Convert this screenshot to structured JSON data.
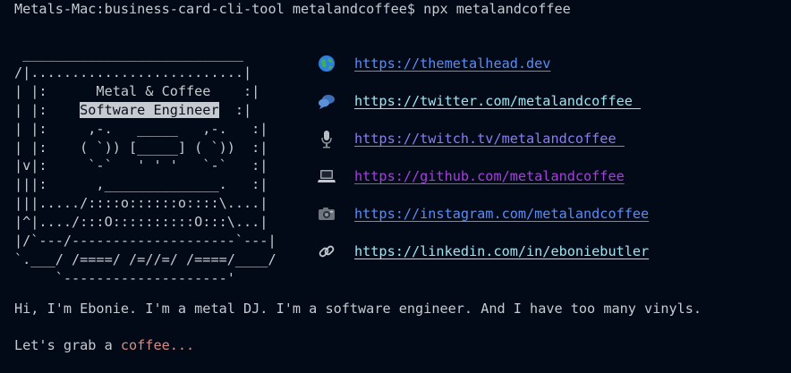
{
  "terminal": {
    "prompt_line": "Metals-Mac:business-card-cli-tool metalandcoffee$ npx metalandcoffee"
  },
  "card": {
    "top_border": " ___________________________",
    "rows": [
      {
        "pre": "/|..........................|",
        "hl": "",
        "post": ""
      },
      {
        "pre": "| |:      Metal & Coffee    :|",
        "hl": "",
        "post": ""
      },
      {
        "pre": "| |:    ",
        "hl": "Software Engineer",
        "post": "  :|"
      },
      {
        "pre": "| |:     ,-.   _____   ,-.   :|",
        "hl": "",
        "post": ""
      },
      {
        "pre": "| |:    ( `)) [_____] ( `))  :|",
        "hl": "",
        "post": ""
      },
      {
        "pre": "|v|:     `-`   ' ' '   `-`   :|",
        "hl": "",
        "post": ""
      },
      {
        "pre": "|||:      ,______________.   :|",
        "hl": "",
        "post": ""
      },
      {
        "pre": "|||...../::::o::::::o::::\\....|",
        "hl": "",
        "post": ""
      },
      {
        "pre": "|^|..../:::O::::::::::O:::\\...|",
        "hl": "",
        "post": ""
      },
      {
        "pre": "|/`---/--------------------`---|",
        "hl": "",
        "post": ""
      },
      {
        "pre": "`.___/ /====/ /=//=/ /====/____/",
        "hl": "",
        "post": ""
      },
      {
        "pre": "     `--------------------'",
        "hl": "",
        "post": ""
      }
    ]
  },
  "links": [
    {
      "icon": "globe-icon",
      "text": "https://themetalhead.dev",
      "color": "#5b8cf5"
    },
    {
      "icon": "speech-bubbles-icon",
      "text": "https://twitter.com/metalandcoffee_",
      "color": "#9fe3f0"
    },
    {
      "icon": "microphone-icon",
      "text": "https://twitch.tv/metalandcoffee_",
      "color": "#8c7cf0"
    },
    {
      "icon": "laptop-icon",
      "text": "https://github.com/metalandcoffee",
      "color": "#a63fdd"
    },
    {
      "icon": "camera-icon",
      "text": "https://instagram.com/metalandcoffee",
      "color": "#5b8cf5"
    },
    {
      "icon": "link-icon",
      "text": "https://linkedin.com/in/eboniebutler",
      "color": "#9fe3f0"
    }
  ],
  "messages": {
    "intro": "Hi, I'm Ebonie. I'm a metal DJ. I'm a software engineer. And I have too many vinyls.",
    "grab_prefix": "Let's grab a ",
    "grab_highlight": "coffee...",
    "highlight_color": "#d88b83"
  }
}
